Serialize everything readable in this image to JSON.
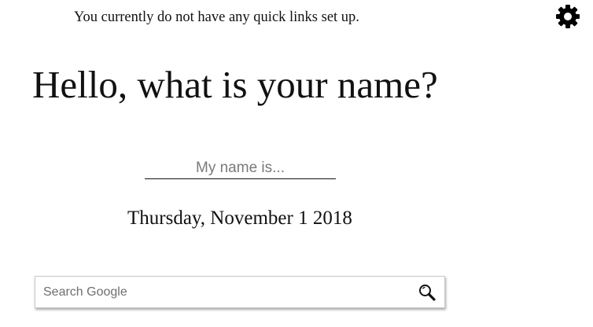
{
  "quick_links": {
    "empty_message": "You currently do not have any quick links set up."
  },
  "settings": {
    "icon": "gear-icon"
  },
  "greeting": {
    "title": "Hello, what is your name?"
  },
  "name_field": {
    "placeholder": "My name is...",
    "value": ""
  },
  "date": {
    "text": "Thursday, November 1 2018"
  },
  "search": {
    "placeholder": "Search Google",
    "value": "",
    "icon": "magnifier-icon"
  }
}
